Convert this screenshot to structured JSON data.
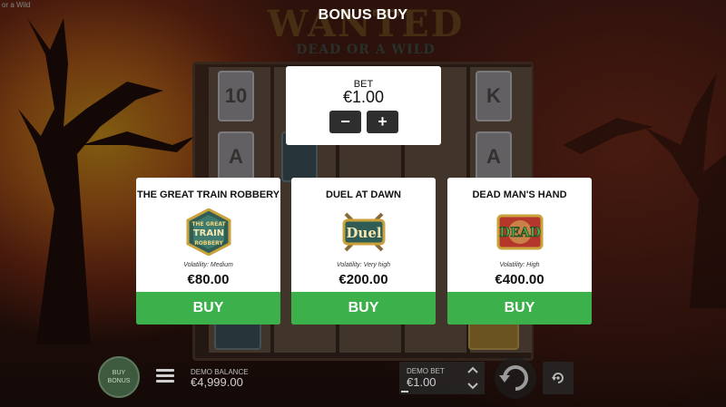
{
  "header": {
    "title": "BONUS BUY"
  },
  "corner_caption": "or a Wild",
  "logo": {
    "main": "WANTED",
    "sub": "DEAD OR A WILD"
  },
  "bet": {
    "label": "BET",
    "value": "€1.00",
    "minus": "−",
    "plus": "+"
  },
  "cards": [
    {
      "title": "THE GREAT TRAIN ROBBERY",
      "volatility": "Volatility: Medium",
      "price": "€80.00",
      "buy_label": "BUY",
      "icon": "great-train-robbery-badge-icon"
    },
    {
      "title": "DUEL AT DAWN",
      "volatility": "Volatility: Very high",
      "price": "€200.00",
      "buy_label": "BUY",
      "icon": "duel-badge-icon"
    },
    {
      "title": "DEAD MAN'S HAND",
      "volatility": "Volatility: High",
      "price": "€400.00",
      "buy_label": "BUY",
      "icon": "dead-badge-icon"
    }
  ],
  "badges": {
    "train_top": "THE GREAT",
    "train_mid": "TRAIN",
    "train_bot": "ROBBERY",
    "duel": "Duel",
    "dead": "DEAD"
  },
  "reel_symbols": [
    "10",
    "K",
    "A",
    "A"
  ],
  "bottom": {
    "buy_bonus": "BUY BONUS",
    "balance_label": "DEMO BALANCE",
    "balance_value": "€4,999.00",
    "bet_label": "DEMO BET",
    "bet_value": "€1.00"
  },
  "colors": {
    "buy_green": "#3cb04a",
    "stepper_dark": "#2e2e2e",
    "panel_white": "#ffffff"
  }
}
